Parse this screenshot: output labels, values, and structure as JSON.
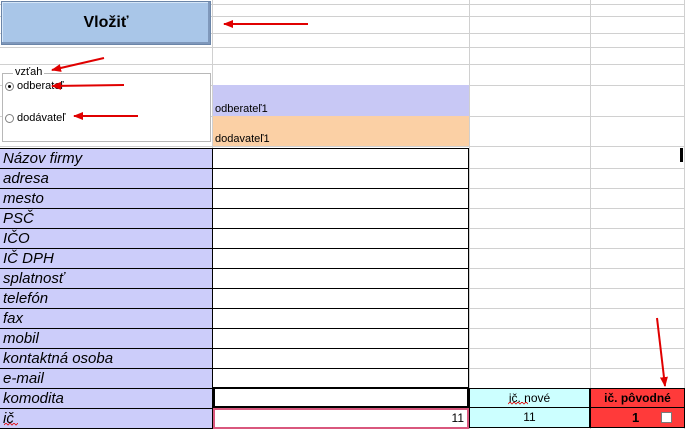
{
  "insert_button": {
    "label": "Vložiť"
  },
  "relation_group": {
    "legend": "vzťah",
    "options": [
      {
        "label": "odberateľ",
        "selected": true
      },
      {
        "label": "dodávateľ",
        "selected": false
      }
    ]
  },
  "type_cells": {
    "odberatel": "odberateľ1",
    "dodavatel": "dodavateľ1"
  },
  "form_labels": [
    "Názov firmy",
    "adresa",
    "mesto",
    "PSČ",
    "IČO",
    "IČ DPH",
    "splatnosť",
    "telefón",
    "fax",
    "mobil",
    "kontaktná osoba",
    "e-mail",
    "komodita",
    "ič"
  ],
  "values": {
    "komodita": "",
    "ic": "11"
  },
  "ic_new": {
    "label": "ič. nové",
    "value": "11"
  },
  "ic_orig": {
    "label": "ič. pôvodné",
    "value": "1",
    "checked": false
  },
  "colors": {
    "label_bg": "#cccdfa",
    "odberatel_bg": "#c8c8f5",
    "dodavatel_bg": "#fbd0a5",
    "ic_new_bg": "#ccffff",
    "ic_orig_bg": "#ff3a3a",
    "button_bg": "#a9c6e8",
    "arrow": "#e00000"
  }
}
